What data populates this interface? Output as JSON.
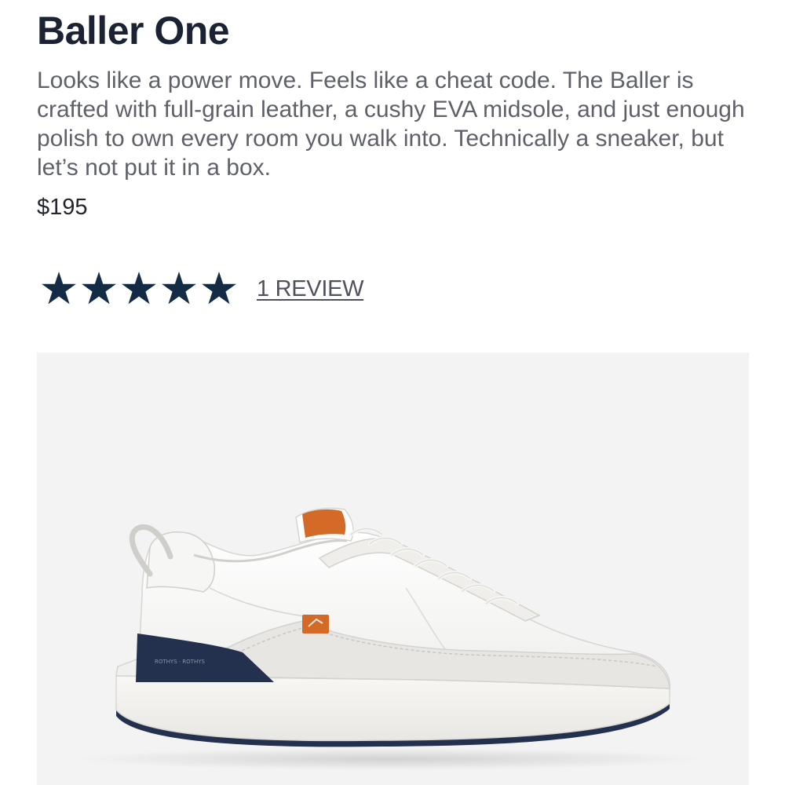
{
  "product": {
    "name": "Baller One",
    "description": "Looks like a power move. Feels like a cheat code. The Baller is crafted with full-grain leather, a cushy EVA midsole, and just enough polish to own every room you walk into. Technically a sneaker, but let’s not put it in a box.",
    "price": "$195"
  },
  "rating": {
    "stars": 5,
    "max_stars": 5,
    "review_link": "1 REVIEW"
  },
  "image": {
    "subject": "white-leather-sneaker",
    "sole_text": "ROTHYS"
  },
  "colors": {
    "title": "#1b2233",
    "star": "#132b45",
    "accent_orange": "#d46a28",
    "navy": "#23314f",
    "image_background": "#f3f3f3"
  }
}
